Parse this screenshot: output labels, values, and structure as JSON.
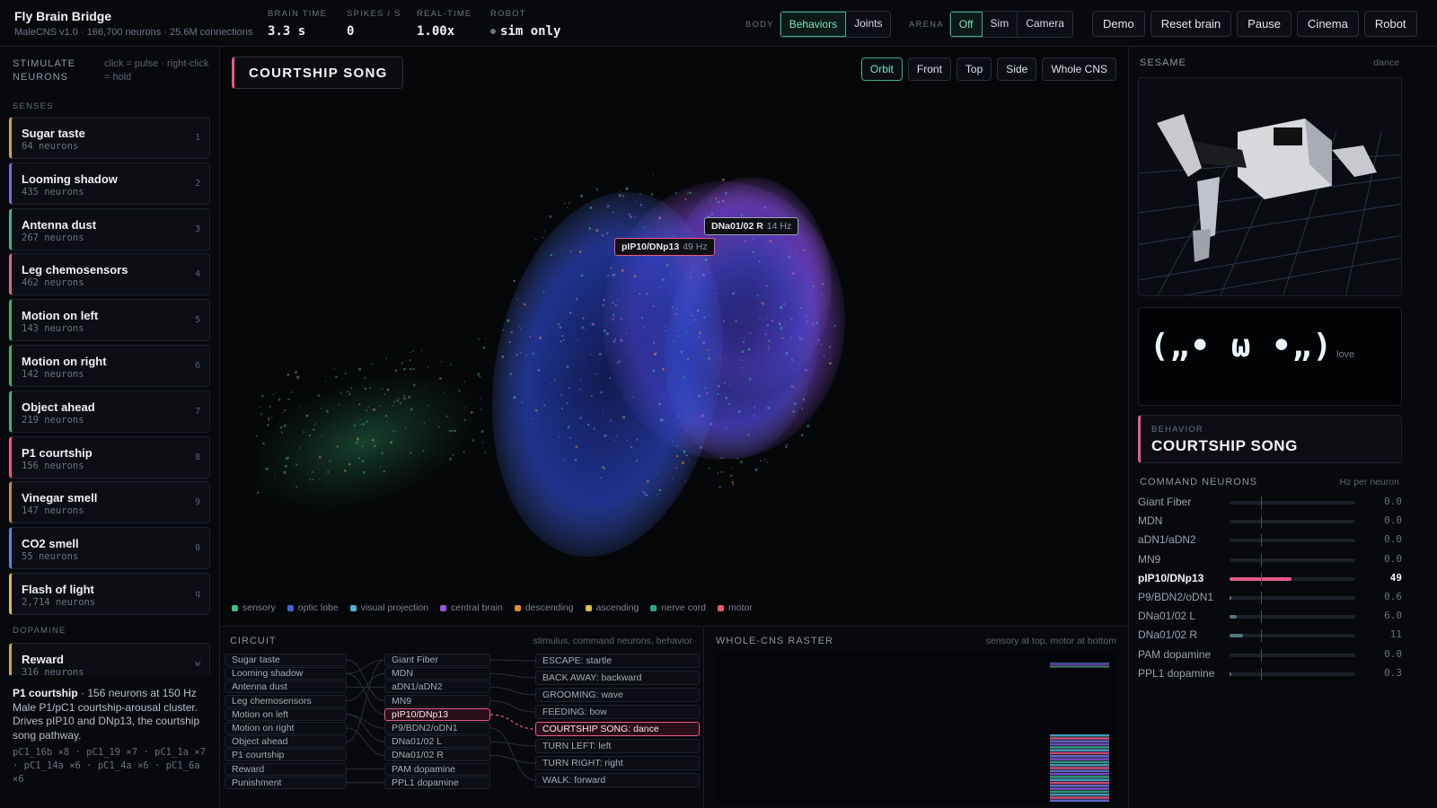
{
  "app": {
    "title": "Fly Brain Bridge",
    "subtitle": "MaleCNS v1.0 · 166,700 neurons · 25.6M connections"
  },
  "stats": [
    {
      "label": "BRAIN TIME",
      "value": "3.3 s"
    },
    {
      "label": "SPIKES / S",
      "value": "0"
    },
    {
      "label": "REAL-TIME",
      "value": "1.00x"
    },
    {
      "label": "ROBOT",
      "value": "sim only"
    }
  ],
  "body_group": {
    "label": "BODY",
    "options": [
      "Behaviors",
      "Joints"
    ],
    "selected": "Behaviors"
  },
  "arena_group": {
    "label": "ARENA",
    "options": [
      "Off",
      "Sim",
      "Camera"
    ],
    "selected": "Off"
  },
  "actions": [
    "Demo",
    "Reset brain",
    "Pause",
    "Cinema",
    "Robot"
  ],
  "stimulate": {
    "title": "STIMULATE NEURONS",
    "hint": "click = pulse · right-click = hold"
  },
  "senses_label": "SENSES",
  "dopamine_label": "DOPAMINE",
  "stimuli": [
    {
      "name": "Sugar taste",
      "count": "64 neurons",
      "key": "1",
      "color": "#c9a64a"
    },
    {
      "name": "Looming shadow",
      "count": "435 neurons",
      "key": "2",
      "color": "#7b6bd6"
    },
    {
      "name": "Antenna dust",
      "count": "267 neurons",
      "key": "3",
      "color": "#4aa89a"
    },
    {
      "name": "Leg chemosensors",
      "count": "462 neurons",
      "key": "4",
      "color": "#d46a8a"
    },
    {
      "name": "Motion on left",
      "count": "143 neurons",
      "key": "5",
      "color": "#3fae70"
    },
    {
      "name": "Motion on right",
      "count": "142 neurons",
      "key": "6",
      "color": "#3fae70"
    },
    {
      "name": "Object ahead",
      "count": "219 neurons",
      "key": "7",
      "color": "#3fae90"
    },
    {
      "name": "P1 courtship",
      "count": "156 neurons",
      "key": "8",
      "color": "#e85a8a"
    },
    {
      "name": "Vinegar smell",
      "count": "147 neurons",
      "key": "9",
      "color": "#c98a4a"
    },
    {
      "name": "CO2 smell",
      "count": "55 neurons",
      "key": "0",
      "color": "#5a8ad6"
    },
    {
      "name": "Flash of light",
      "count": "2,714 neurons",
      "key": "q",
      "color": "#d6c24a"
    }
  ],
  "dopamine": [
    {
      "name": "Reward",
      "count": "316 neurons",
      "key": "w",
      "color": "#c9a64a"
    }
  ],
  "selected_info": {
    "name": "P1 courtship",
    "rest": " · 156 neurons at 150 Hz Male P1/pC1 courtship-arousal cluster. Drives pIP10 and DNp13, the courtship song pathway.",
    "cells": "pC1_16b ×8 · pC1_19 ×7 · pC1_1a ×7 · pC1_14a ×6 · pC1_4a ×6 · pC1_6a ×6"
  },
  "view_title": "COURTSHIP SONG",
  "views": [
    "Orbit",
    "Front",
    "Top",
    "Side",
    "Whole CNS"
  ],
  "selected_view": "Orbit",
  "tooltips": [
    {
      "name": "DNa01/02 R",
      "value": "14 Hz"
    },
    {
      "name": "pIP10/DNp13",
      "value": "49 Hz"
    }
  ],
  "legend": [
    {
      "label": "sensory",
      "color": "#3fbf7f"
    },
    {
      "label": "optic lobe",
      "color": "#3f62d6"
    },
    {
      "label": "visual projection",
      "color": "#4ab3d6"
    },
    {
      "label": "central brain",
      "color": "#9a55e0"
    },
    {
      "label": "descending",
      "color": "#e08a3a"
    },
    {
      "label": "ascending",
      "color": "#e0c04a"
    },
    {
      "label": "nerve cord",
      "color": "#2fa88e"
    },
    {
      "label": "motor",
      "color": "#e85a6a"
    }
  ],
  "circuit": {
    "title": "CIRCUIT",
    "subtitle": "stimulus, command neurons, behavior",
    "inputs": [
      "Sugar taste",
      "Looming shadow",
      "Antenna dust",
      "Leg chemosensors",
      "Motion on left",
      "Motion on right",
      "Object ahead",
      "P1 courtship",
      "Reward",
      "Punishment"
    ],
    "commands": [
      "Giant Fiber",
      "MDN",
      "aDN1/aDN2",
      "MN9",
      "pIP10/DNp13",
      "P9/BDN2/oDN1",
      "DNa01/02 L",
      "DNa01/02 R",
      "PAM dopamine",
      "PPL1 dopamine"
    ],
    "behaviors": [
      "ESCAPE: startle",
      "BACK AWAY: backward",
      "GROOMING: wave",
      "FEEDING: bow",
      "COURTSHIP SONG: dance",
      "TURN LEFT: left",
      "TURN RIGHT: right",
      "WALK: forward"
    ],
    "active_command": "pIP10/DNp13",
    "active_behavior": "COURTSHIP SONG: dance"
  },
  "raster": {
    "title": "WHOLE-CNS RASTER",
    "subtitle": "sensory at top, motor at bottom"
  },
  "robot_panel": {
    "title": "SESAME",
    "mode": "dance"
  },
  "face": {
    "emoticon": "(„• ω •„)",
    "mood": "love"
  },
  "behavior": {
    "label": "BEHAVIOR",
    "value": "COURTSHIP SONG"
  },
  "command_neurons": {
    "title": "COMMAND NEURONS",
    "unit": "Hz per neuron",
    "rows": [
      {
        "name": "Giant Fiber",
        "value": "0.0",
        "level": 0.0
      },
      {
        "name": "MDN",
        "value": "0.0",
        "level": 0.0
      },
      {
        "name": "aDN1/aDN2",
        "value": "0.0",
        "level": 0.0
      },
      {
        "name": "MN9",
        "value": "0.0",
        "level": 0.0
      },
      {
        "name": "pIP10/DNp13",
        "value": "49",
        "level": 0.49,
        "active": true
      },
      {
        "name": "P9/BDN2/oDN1",
        "value": "0.6",
        "level": 0.006
      },
      {
        "name": "DNa01/02 L",
        "value": "6.0",
        "level": 0.06
      },
      {
        "name": "DNa01/02 R",
        "value": "11",
        "level": 0.11
      },
      {
        "name": "PAM dopamine",
        "value": "0.0",
        "level": 0.0
      },
      {
        "name": "PPL1 dopamine",
        "value": "0.3",
        "level": 0.003
      }
    ]
  }
}
